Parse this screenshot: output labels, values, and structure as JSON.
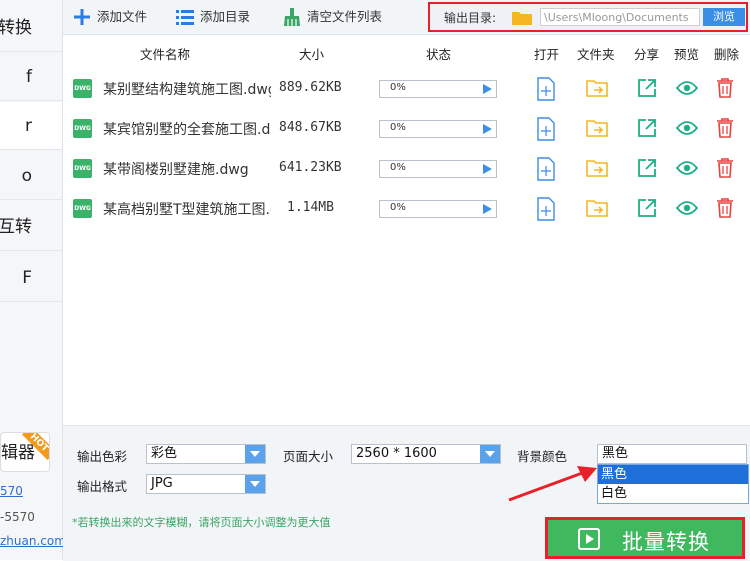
{
  "sidebar": {
    "items": [
      "转换",
      "f",
      "r",
      "o",
      "互转",
      "F"
    ],
    "hot_label": "辑器",
    "hot_badge": "HOT",
    "link1": "570",
    "text2": "-5570",
    "link3": "zhuan.com"
  },
  "toolbar": {
    "add_file": "添加文件",
    "add_dir": "添加目录",
    "clear_list": "清空文件列表",
    "output_label": "输出目录:",
    "output_path": "\\Users\\Mloong\\Documents",
    "browse": "浏览"
  },
  "table": {
    "headers": {
      "name": "文件名称",
      "size": "大小",
      "status": "状态",
      "open": "打开",
      "folder": "文件夹",
      "share": "分享",
      "preview": "预览",
      "delete": "删除"
    },
    "file_badge": "DWG",
    "rows": [
      {
        "name": "某别墅结构建筑施工图.dwg",
        "size": "889.62KB",
        "progress": "0%"
      },
      {
        "name": "某宾馆别墅的全套施工图.dwg",
        "size": "848.67KB",
        "progress": "0%"
      },
      {
        "name": "某带阁楼别墅建施.dwg",
        "size": "641.23KB",
        "progress": "0%"
      },
      {
        "name": "某高档别墅T型建筑施工图.dwg",
        "size": "1.14MB",
        "progress": "0%"
      }
    ]
  },
  "options": {
    "color_label": "输出色彩",
    "color_value": "彩色",
    "page_size_label": "页面大小",
    "page_size_value": "2560 * 1600",
    "bg_label": "背景颜色",
    "bg_value": "黑色",
    "bg_options": [
      "黑色",
      "白色"
    ],
    "format_label": "输出格式",
    "format_value": "JPG"
  },
  "hint": "*若转换出来的文字模糊，请将页面大小调整为更大值",
  "convert_button": "批量转换",
  "colors": {
    "accent_blue": "#3a8ee6",
    "green": "#3fb85e",
    "highlight_red": "#e8202a",
    "folder_yellow": "#f5b621",
    "icon_teal": "#1fae86",
    "delete_red": "#e0463d"
  }
}
